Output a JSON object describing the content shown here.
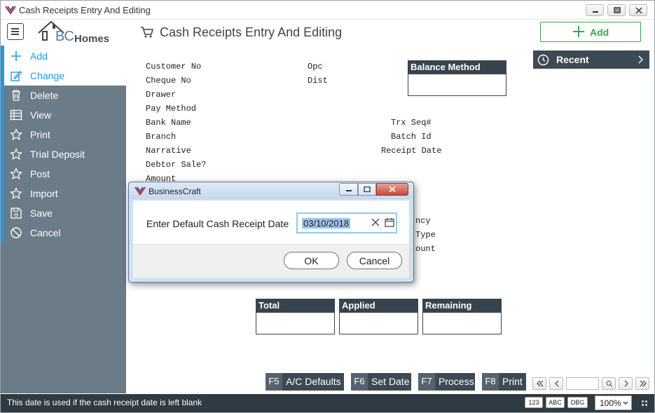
{
  "window": {
    "title": "Cash Receipts Entry And Editing"
  },
  "header": {
    "brand_bc": "BC",
    "brand_homes": "Homes",
    "page_title": "Cash Receipts Entry And Editing",
    "add_label": "Add"
  },
  "sidebar": {
    "items": [
      {
        "label": "Add",
        "icon": "plus-icon"
      },
      {
        "label": "Change",
        "icon": "edit-icon"
      },
      {
        "label": "Delete",
        "icon": "trash-icon"
      },
      {
        "label": "View",
        "icon": "table-icon"
      },
      {
        "label": "Print",
        "icon": "star-icon"
      },
      {
        "label": "Trial Deposit",
        "icon": "star-icon"
      },
      {
        "label": "Post",
        "icon": "star-icon"
      },
      {
        "label": "Import",
        "icon": "star-icon"
      },
      {
        "label": "Save",
        "icon": "save-icon"
      },
      {
        "label": "Cancel",
        "icon": "cancel-icon"
      }
    ]
  },
  "form": {
    "left_labels": [
      "Customer No",
      "Cheque No",
      "Drawer",
      "Pay Method",
      "Bank Name",
      "Branch",
      "Narrative",
      "Debtor Sale?",
      "Amount"
    ],
    "mid_labels": [
      "Opc",
      "Dist"
    ],
    "right_labels": [
      "Trx Seq#",
      "Batch Id",
      "Receipt Date"
    ],
    "partial_labels": [
      "ncy",
      "Type",
      "ount"
    ]
  },
  "balance_method": {
    "title": "Balance Method"
  },
  "recent": {
    "label": "Recent"
  },
  "totals": [
    {
      "title": "Total"
    },
    {
      "title": "Applied"
    },
    {
      "title": "Remaining"
    }
  ],
  "fkeys": [
    {
      "key": "F5",
      "label": "A/C Defaults"
    },
    {
      "key": "F6",
      "label": "Set Date"
    },
    {
      "key": "F7",
      "label": "Process"
    },
    {
      "key": "F8",
      "label": "Print"
    }
  ],
  "status": {
    "message": "This date is used if the cash receipt date is left blank",
    "badges": [
      "123",
      "ABC",
      "DBG"
    ],
    "zoom": "100%"
  },
  "modal": {
    "title": "BusinessCraft",
    "prompt": "Enter Default Cash Receipt Date",
    "date_value": "03/10/2018",
    "ok_label": "OK",
    "cancel_label": "Cancel"
  },
  "colors": {
    "accent": "#1e9be0",
    "sidebar": "#6b7b87",
    "dark_header": "#38444d",
    "add_green": "#3aa64a",
    "status_bar": "#2f3a42"
  }
}
